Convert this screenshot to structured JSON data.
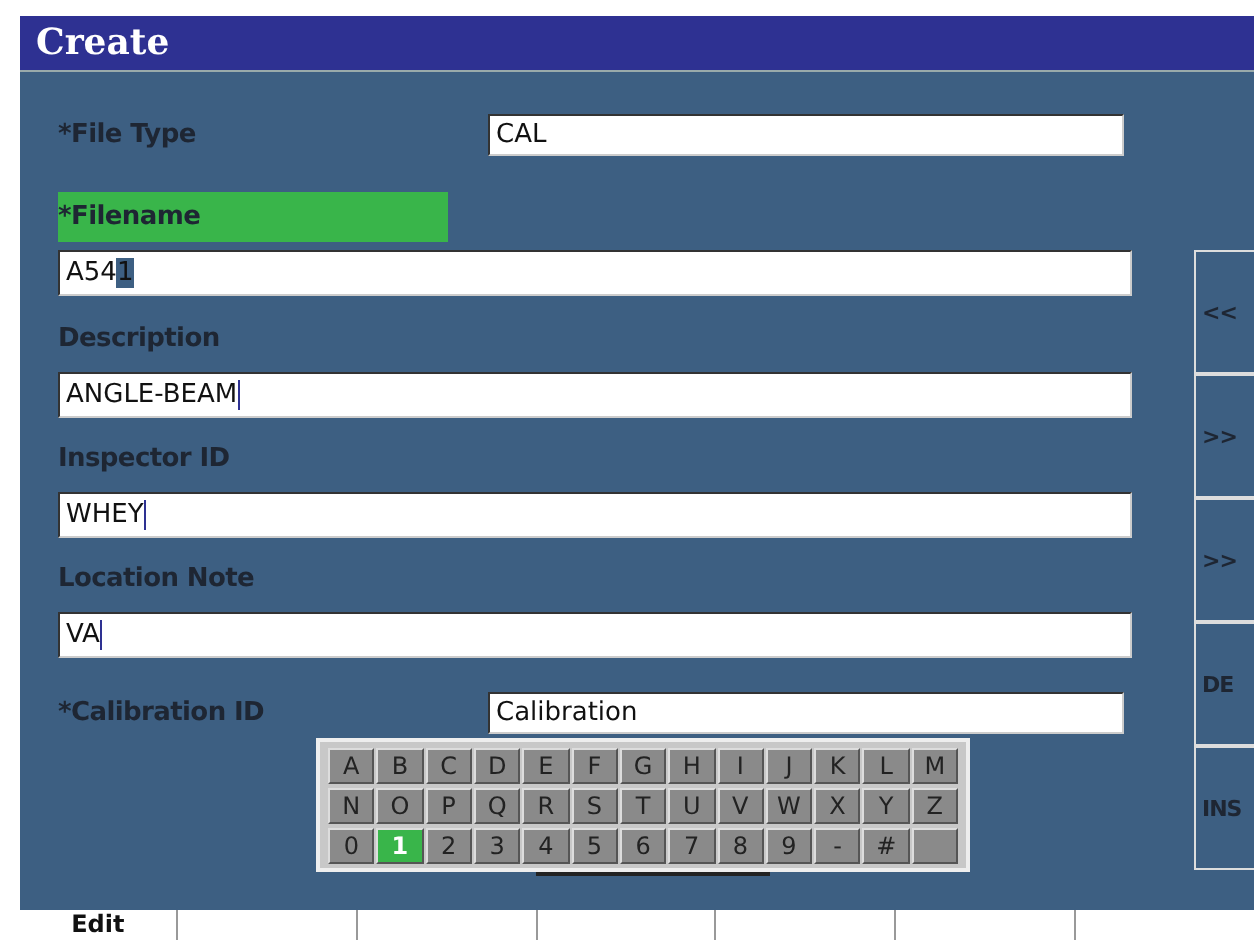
{
  "window": {
    "title": "Create"
  },
  "fields": [
    {
      "kind": "inline",
      "label": "*File Type",
      "selected": false,
      "value": "CAL"
    },
    {
      "kind": "stacked",
      "label": "*Filename",
      "selected": true,
      "value": "A54",
      "selection": "1"
    },
    {
      "kind": "stacked",
      "label": "Description",
      "selected": false,
      "value": "ANGLE-BEAM",
      "caret": true
    },
    {
      "kind": "stacked",
      "label": "Inspector ID",
      "selected": false,
      "value": "WHEY",
      "caret": true
    },
    {
      "kind": "stacked",
      "label": "Location Note",
      "selected": false,
      "value": "VA",
      "caret": true
    },
    {
      "kind": "inline",
      "label": "*Calibration ID",
      "selected": false,
      "value": "Calibration"
    }
  ],
  "keyboard": [
    [
      {
        "label": "A",
        "selected": false
      },
      {
        "label": "B",
        "selected": false
      },
      {
        "label": "C",
        "selected": false
      },
      {
        "label": "D",
        "selected": false
      },
      {
        "label": "E",
        "selected": false
      },
      {
        "label": "F",
        "selected": false
      },
      {
        "label": "G",
        "selected": false
      },
      {
        "label": "H",
        "selected": false
      },
      {
        "label": "I",
        "selected": false
      },
      {
        "label": "J",
        "selected": false
      },
      {
        "label": "K",
        "selected": false
      },
      {
        "label": "L",
        "selected": false
      },
      {
        "label": "M",
        "selected": false
      }
    ],
    [
      {
        "label": "N",
        "selected": false
      },
      {
        "label": "O",
        "selected": false
      },
      {
        "label": "P",
        "selected": false
      },
      {
        "label": "Q",
        "selected": false
      },
      {
        "label": "R",
        "selected": false
      },
      {
        "label": "S",
        "selected": false
      },
      {
        "label": "T",
        "selected": false
      },
      {
        "label": "U",
        "selected": false
      },
      {
        "label": "V",
        "selected": false
      },
      {
        "label": "W",
        "selected": false
      },
      {
        "label": "X",
        "selected": false
      },
      {
        "label": "Y",
        "selected": false
      },
      {
        "label": "Z",
        "selected": false
      }
    ],
    [
      {
        "label": "0",
        "selected": false
      },
      {
        "label": "1",
        "selected": true
      },
      {
        "label": "2",
        "selected": false
      },
      {
        "label": "3",
        "selected": false
      },
      {
        "label": "4",
        "selected": false
      },
      {
        "label": "5",
        "selected": false
      },
      {
        "label": "6",
        "selected": false
      },
      {
        "label": "7",
        "selected": false
      },
      {
        "label": "8",
        "selected": false
      },
      {
        "label": "9",
        "selected": false
      },
      {
        "label": "-",
        "selected": false
      },
      {
        "label": "#",
        "selected": false
      },
      {
        "selected": false
      }
    ]
  ],
  "side_buttons": [
    "<<",
    ">>",
    ">>",
    "DE",
    "INS"
  ],
  "bottom_tabs": [
    {
      "label": "Edit"
    }
  ]
}
